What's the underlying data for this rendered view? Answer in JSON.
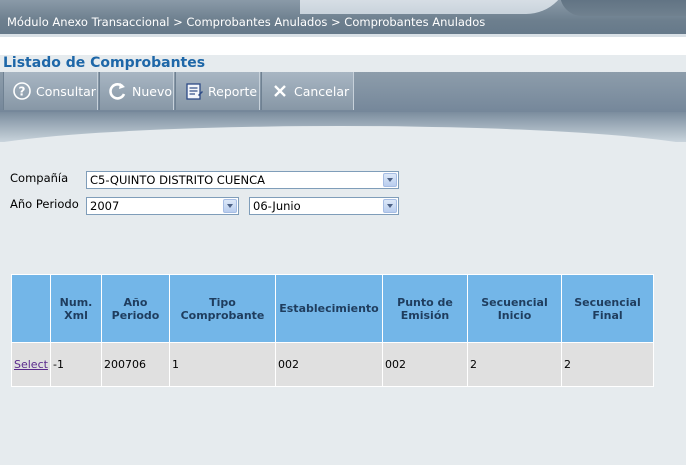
{
  "header": {
    "breadcrumb": "Módulo Anexo Transaccional > Comprobantes Anulados > Comprobantes Anulados"
  },
  "page": {
    "title": "Listado de Comprobantes"
  },
  "toolbar": {
    "buttons": [
      {
        "label": "Consultar",
        "icon": "question-icon"
      },
      {
        "label": "Nuevo",
        "icon": "refresh-new-icon"
      },
      {
        "label": "Reporte",
        "icon": "report-icon"
      },
      {
        "label": "Cancelar",
        "icon": "cancel-x-icon"
      }
    ]
  },
  "form": {
    "company_label": "Compañía",
    "company_value": "C5-QUINTO DISTRITO CUENCA",
    "period_label": "Año Periodo",
    "year_value": "2007",
    "month_value": "06-Junio"
  },
  "table": {
    "columns": [
      "",
      "Num. Xml",
      "Año Periodo",
      "Tipo Comprobante",
      "Establecimiento",
      "Punto de Emisión",
      "Secuencial Inicio",
      "Secuencial Final"
    ],
    "rows": [
      {
        "action": "Select",
        "num_xml": "-1",
        "anio_periodo": "200706",
        "tipo": "1",
        "establecimiento": "002",
        "punto": "002",
        "sec_inicio": "2",
        "sec_final": "2"
      }
    ]
  },
  "colors": {
    "header_blue": "#73b6e8",
    "title_blue": "#1e67a8",
    "toolbar_gray": "#8d9dab"
  }
}
